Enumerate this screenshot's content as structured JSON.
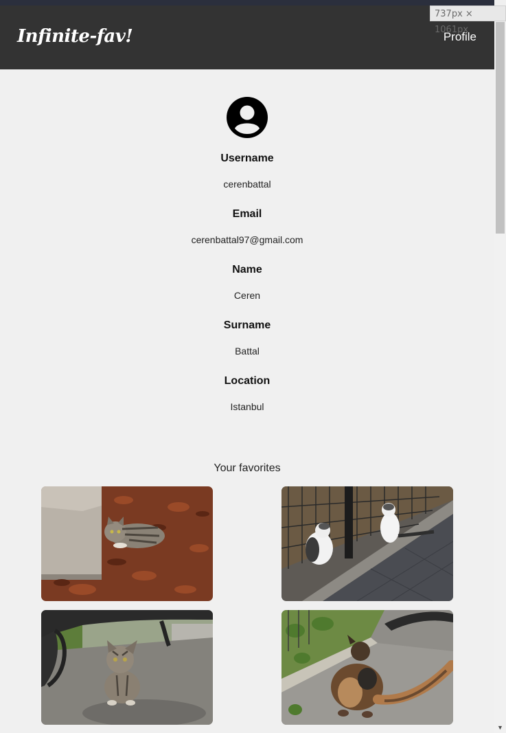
{
  "window": {
    "size_badge": "737px × 1061px"
  },
  "navbar": {
    "brand": "Infinite-fav!",
    "profile_link": "Profile"
  },
  "profile": {
    "avatar_icon": "user-circle-icon",
    "fields": {
      "username": {
        "label": "Username",
        "value": "cerenbattal"
      },
      "email": {
        "label": "Email",
        "value": "cerenbattal97@gmail.com"
      },
      "name": {
        "label": "Name",
        "value": "Ceren"
      },
      "surname": {
        "label": "Surname",
        "value": "Battal"
      },
      "location": {
        "label": "Location",
        "value": "Istanbul"
      }
    }
  },
  "favorites": {
    "title": "Your favorites"
  },
  "colors": {
    "navbar_bg": "#333333",
    "page_bg": "#f0f0f0",
    "text": "#111111"
  }
}
